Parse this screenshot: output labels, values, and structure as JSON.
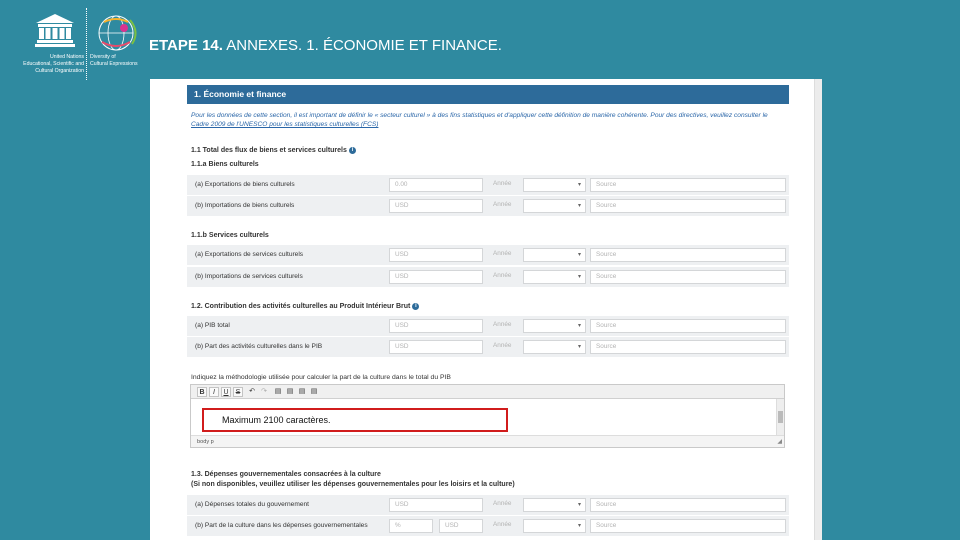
{
  "header": {
    "title_bold": "ETAPE 14.",
    "title_rest": " ANNEXES. 1. ÉCONOMIE ET FINANCE.",
    "unesco_lines": [
      "United Nations",
      "Educational, Scientific and",
      "Cultural Organization"
    ],
    "convention_lines": [
      "Diversity of",
      "Cultural Expressions"
    ]
  },
  "panel": {
    "title": "1. Économie et finance",
    "intro_text": "Pour les données de cette section, il est important de définir le « secteur culturel » à des fins statistiques et d'appliquer cette définition de manière cohérente. Pour des directives, veuillez consulter le ",
    "intro_link": "Cadre 2009 de l'UNESCO pour les statistiques culturelles (FCS)"
  },
  "sections": {
    "s11_title": "1.1 Total des flux de biens et services culturels",
    "s11a_title": "1.1.a Biens culturels",
    "s11b_title": "1.1.b Services culturels",
    "s12_title": "1.2. Contribution des activités culturelles au Produit Intérieur Brut",
    "s13_title_1": "1.3. Dépenses gouvernementales consacrées à la culture",
    "s13_title_2": "(Si non disponibles, veuillez utiliser les dépenses gouvernementales pour les loisirs et la culture)"
  },
  "rows": {
    "r1": "(a) Exportations de biens culturels",
    "r2": "(b) Importations de biens culturels",
    "r3": "(a) Exportations de services culturels",
    "r4": "(b) Importations de services culturels",
    "r5": "(a) PIB total",
    "r6": "(b) Part des activités culturelles dans le PIB",
    "r7": "(a) Dépenses totales du gouvernement",
    "r8": "(b) Part de la culture dans les dépenses gouvernementales"
  },
  "placeholders": {
    "currency": "USD",
    "currency_first": "0.00",
    "year": "Année",
    "source": "Source",
    "percent": "%"
  },
  "methodology": {
    "label": "Indiquez la méthodologie utilisée pour calculer la part de la culture dans le total du PIB",
    "toolbar_buttons": [
      "B",
      "I",
      "U",
      "S",
      "↶",
      "↷",
      "▤",
      "▤",
      "▤",
      "▤"
    ],
    "status_path": "body  p",
    "callout": "Maximum 2100 caractères."
  },
  "colors": {
    "slide_bg": "#2f8aa0",
    "panel_header": "#2d6b9a",
    "callout_border": "#d11c1c"
  }
}
